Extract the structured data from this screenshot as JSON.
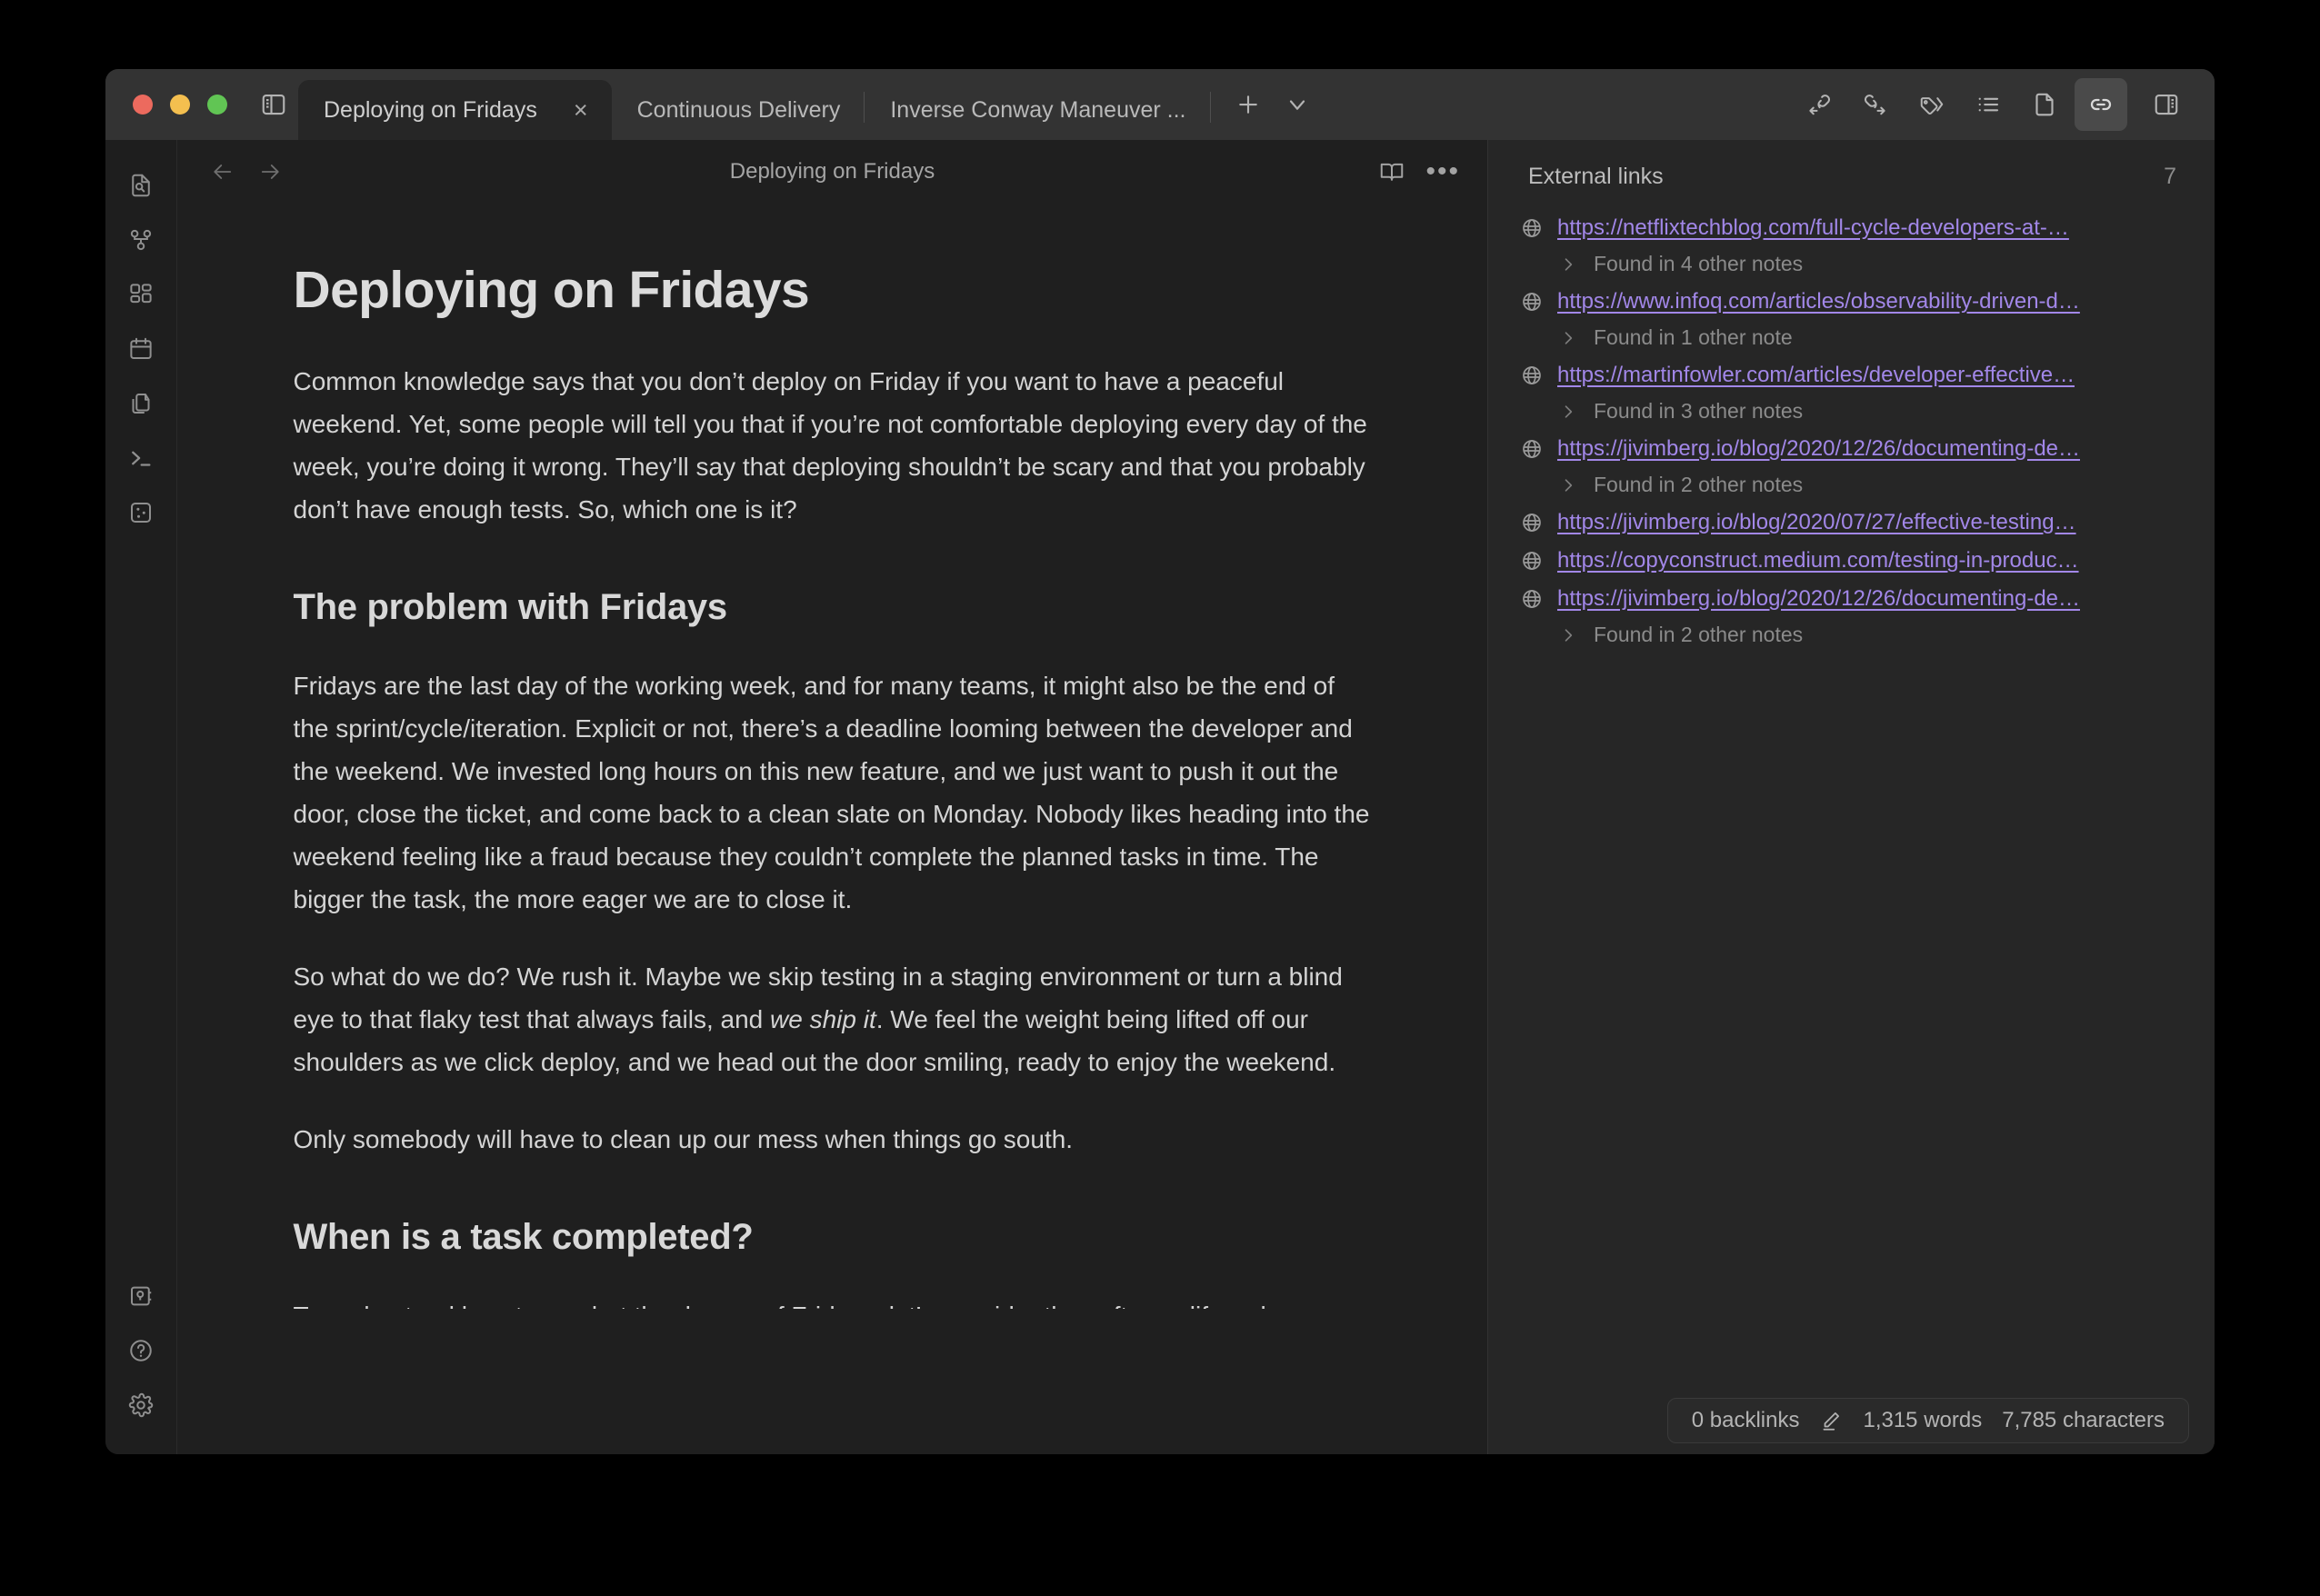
{
  "window": {
    "traffic_lights": {
      "close_color": "#ec6a5e",
      "minimize_color": "#f4bf4f",
      "maximize_color": "#61c554"
    }
  },
  "tabs": [
    {
      "label": "Deploying on Fridays",
      "active": true,
      "close_label": "×"
    },
    {
      "label": "Continuous Delivery",
      "active": false
    },
    {
      "label": "Inverse Conway Maneuver ...",
      "active": false
    }
  ],
  "tab_actions": {
    "new_tab_label": "+",
    "tab_list_label": "v"
  },
  "toolbar": {
    "backlinks_label": "Backlinks",
    "outgoing_links_label": "Outgoing links",
    "tags_label": "Tags",
    "outline_label": "Outline",
    "page_preview_label": "Page preview",
    "external_links_label": "External links",
    "right_sidebar_label": "Toggle right sidebar",
    "left_sidebar_label": "Toggle left sidebar",
    "active_tool": "external-links"
  },
  "ribbon": {
    "items": [
      {
        "name": "quick-switcher",
        "label": "Quick switcher"
      },
      {
        "name": "graph-view",
        "label": "Graph view"
      },
      {
        "name": "canvas",
        "label": "Canvas"
      },
      {
        "name": "daily-note",
        "label": "Daily note"
      },
      {
        "name": "templates",
        "label": "Templates"
      },
      {
        "name": "terminal",
        "label": "Terminal"
      },
      {
        "name": "local-graph",
        "label": "Local graph"
      }
    ],
    "bottom_items": [
      {
        "name": "vault",
        "label": "Open another vault"
      },
      {
        "name": "help",
        "label": "Help"
      },
      {
        "name": "settings",
        "label": "Settings"
      }
    ]
  },
  "note_header": {
    "title": "Deploying on Fridays",
    "back_label": "Back",
    "forward_label": "Forward",
    "reading_view_label": "Reading view",
    "more_label": "•••"
  },
  "note": {
    "h1": "Deploying on Fridays",
    "p1": "Common knowledge says that you don’t deploy on Friday if you want to have a peaceful weekend. Yet, some people will tell you that if you’re not comfortable deploying every day of the week, you’re doing it wrong. They’ll say that deploying shouldn’t be scary and that you probably don’t have enough tests. So, which one is it?",
    "h2_a": "The problem with Fridays",
    "p2": "Fridays are the last day of the working week, and for many teams, it might also be the end of the sprint/cycle/iteration. Explicit or not, there’s a deadline looming between the developer and the weekend. We invested long hours on this new feature, and we just want to push it out the door, close the ticket, and come back to a clean slate on Monday. Nobody likes heading into the weekend feeling like a fraud because they couldn’t complete the planned tasks in time. The bigger the task, the more eager we are to close it.",
    "p3_part1": "So what do we do? We rush it. Maybe we skip testing in a staging environment or turn a blind eye to that flaky test that always fails, and ",
    "p3_em": "we ship it",
    "p3_part2": ". We feel the weight being lifted off our shoulders as we click deploy, and we head out the door smiling, ready to enjoy the weekend.",
    "p4": "Only somebody will have to clean up our mess when things go south.",
    "h2_b": "When is a task completed?",
    "p5_clipped": "To understand how to combat the danger of Fridays, let’s consider the software lifecycle"
  },
  "right_panel": {
    "title": "External links",
    "count": "7",
    "links": [
      {
        "url": "https://netflixtechblog.com/full-cycle-developers-at-…",
        "found_in": "Found in 4 other notes"
      },
      {
        "url": "https://www.infoq.com/articles/observability-driven-d…",
        "found_in": "Found in 1 other note"
      },
      {
        "url": "https://martinfowler.com/articles/developer-effective…",
        "found_in": "Found in 3 other notes"
      },
      {
        "url": "https://jivimberg.io/blog/2020/12/26/documenting-de…",
        "found_in": "Found in 2 other notes"
      },
      {
        "url": "https://jivimberg.io/blog/2020/07/27/effective-testing…",
        "found_in": null
      },
      {
        "url": "https://copyconstruct.medium.com/testing-in-produc…",
        "found_in": null
      },
      {
        "url": "https://jivimberg.io/blog/2020/12/26/documenting-de…",
        "found_in": "Found in 2 other notes"
      }
    ],
    "link_color": "#a287e8"
  },
  "status_bar": {
    "backlinks": "0 backlinks",
    "words": "1,315 words",
    "characters": "7,785 characters"
  }
}
